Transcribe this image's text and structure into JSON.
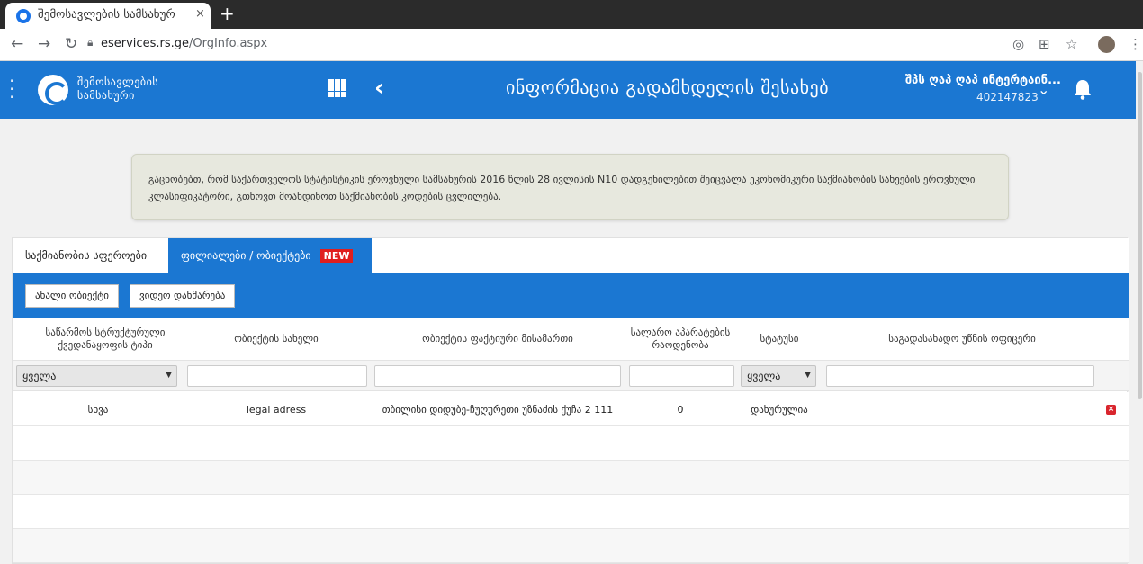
{
  "browser": {
    "tab_title": "შემოსავლების სამსახურ",
    "new_tab": "+",
    "close_tab": "×",
    "url_host": "eservices.rs.ge",
    "url_path": "/OrgInfo.aspx"
  },
  "header": {
    "logo_line1": "შემოსავლების",
    "logo_line2": "სამსახური",
    "title": "ინფორმაცია გადამხდელის შესახებ",
    "user_name": "შპს ღაპ ღაპ ინტერტაინ...",
    "user_id": "402147823"
  },
  "notice": "გაცნობებთ, რომ საქართველოს სტატისტიკის ეროვნული სამსახურის 2016 წლის 28 ივლისის N10 დადგენილებით შეიცვალა ეკონომიკური საქმიანობის სახეების ეროვნული კლასიფიკატორი, გთხოვთ მოახდინოთ საქმიანობის კოდების ცვლილება.",
  "tabs": {
    "activity": "საქმიანობის სფეროები",
    "branches": "ფილიალები / ობიექტები",
    "badge": "NEW"
  },
  "toolbar": {
    "new_object": "ახალი ობიექტი",
    "video_help": "ვიდეო დახმარება"
  },
  "table": {
    "headers": {
      "type": "საწარმოს სტრუქტურული ქვედანაყოფის ტიპი",
      "name": "ობიექტის სახელი",
      "address": "ობიექტის ფაქტიური მისამართი",
      "cash_registers": "სალარო აპარატების რაოდენობა",
      "status": "სტატუსი",
      "officer": "საგადასახადო უწნის ოფიცერი"
    },
    "filters": {
      "type_select": "ყველა",
      "status_select": "ყველა"
    },
    "rows": [
      {
        "type": "სხვა",
        "name": "legal adress",
        "address": "თბილისი დიდუბე-ჩუღურეთი უზნაძის ქუჩა 2 111",
        "cash_registers": "0",
        "status": "დახურულია"
      }
    ]
  }
}
